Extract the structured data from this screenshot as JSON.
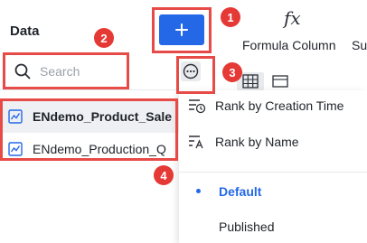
{
  "panel": {
    "title": "Data",
    "search_placeholder": "Search",
    "items": [
      {
        "label": "ENdemo_Product_Sale",
        "selected": true
      },
      {
        "label": "ENdemo_Production_Q",
        "selected": false
      }
    ]
  },
  "toolbar": {
    "add_icon": "plus-icon",
    "more_icon": "ellipsis-icon",
    "formula_icon": "fx",
    "formula_label": "Formula Column",
    "next_label": "Su"
  },
  "menu": {
    "sort": [
      {
        "label": "Rank by Creation Time",
        "icon": "sort-time-icon"
      },
      {
        "label": "Rank by Name",
        "icon": "sort-name-icon"
      }
    ],
    "options": [
      {
        "label": "Default",
        "selected": true
      },
      {
        "label": "Published",
        "selected": false
      }
    ]
  },
  "annotations": [
    "1",
    "2",
    "3",
    "4"
  ],
  "colors": {
    "accent": "#2468e8",
    "annotation": "#e53935"
  }
}
